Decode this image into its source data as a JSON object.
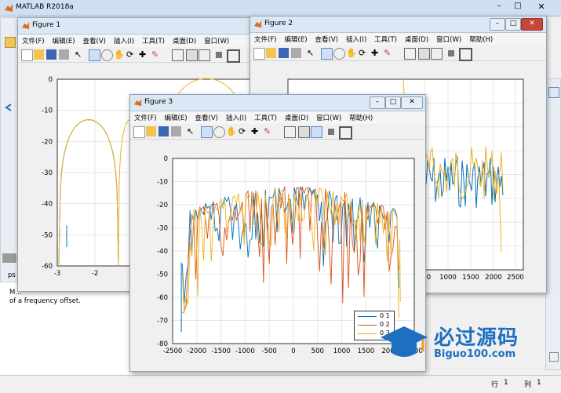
{
  "app": {
    "title": "MATLAB R2018a",
    "cmd_text": "M...\nof a frequency offset.",
    "cmd_prefix": "ps",
    "status_row_label": "行",
    "status_row": "1",
    "status_col_label": "列",
    "status_col": "1"
  },
  "menus": [
    "文件(F)",
    "编辑(E)",
    "查看(V)",
    "插入(I)",
    "工具(T)",
    "桌面(D)",
    "窗口(W)",
    "帮助(H)"
  ],
  "fig1": {
    "title": "Figure 1",
    "yticks": [
      "0",
      "-10",
      "-20",
      "-30",
      "-40",
      "-50",
      "-60"
    ],
    "xticks": [
      "-3",
      "-2"
    ]
  },
  "fig2": {
    "title": "Figure 2",
    "xticks": [
      "500",
      "1000",
      "1500",
      "2000",
      "2500"
    ]
  },
  "fig3": {
    "title": "Figure 3",
    "yticks": [
      "0",
      "-10",
      "-20",
      "-30",
      "-40",
      "-50",
      "-60",
      "-70",
      "-80"
    ],
    "xticks": [
      "-2500",
      "-2000",
      "-1500",
      "-1000",
      "-500",
      "0",
      "500",
      "1000",
      "1500",
      "2000",
      "2500"
    ],
    "legend": [
      "0 1",
      "0 2",
      "0 3"
    ]
  },
  "watermark": {
    "cn": "必过源码",
    "url": "Biguo100.com"
  },
  "colors": {
    "series1": "#0072bd",
    "series2": "#d95319",
    "series3": "#edb120",
    "title_bar": "#dbe7f4"
  }
}
